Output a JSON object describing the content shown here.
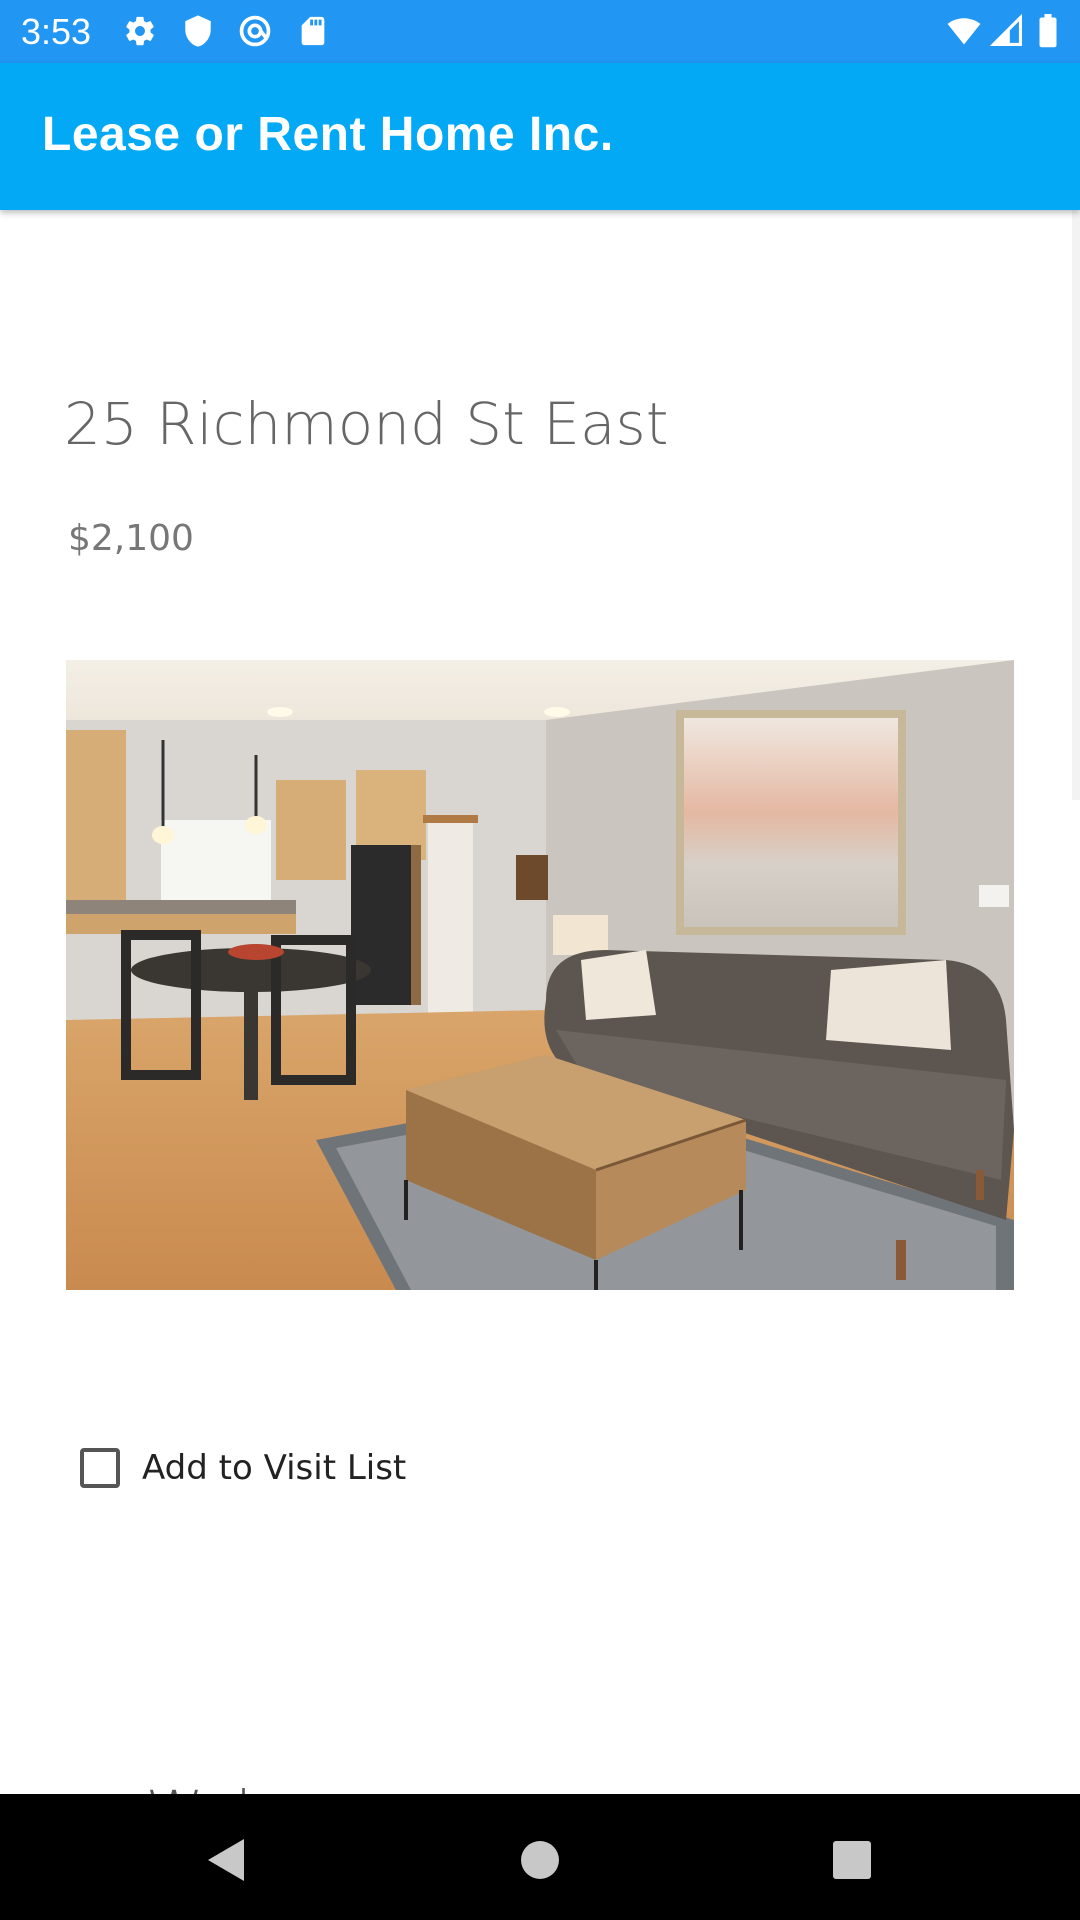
{
  "status_bar": {
    "time": "3:53",
    "left_icons": [
      "gear-icon",
      "shield-icon",
      "at-sign-icon",
      "sd-card-icon"
    ],
    "right_icons": [
      "wifi-icon",
      "cellular-signal-icon",
      "battery-icon"
    ],
    "background_color": "#2196f3"
  },
  "app_bar": {
    "title": "Lease or Rent Home Inc.",
    "background_color": "#03a9f4"
  },
  "listing": {
    "address": "25 Richmond St East",
    "price": "$2,100",
    "photo": "living-room-photo",
    "visit_checkbox": {
      "label": "Add to Visit List",
      "checked": false
    },
    "next_section_heading_partial": "Wel"
  },
  "nav_bar": {
    "buttons": [
      "back-icon",
      "home-icon",
      "recents-icon"
    ]
  }
}
